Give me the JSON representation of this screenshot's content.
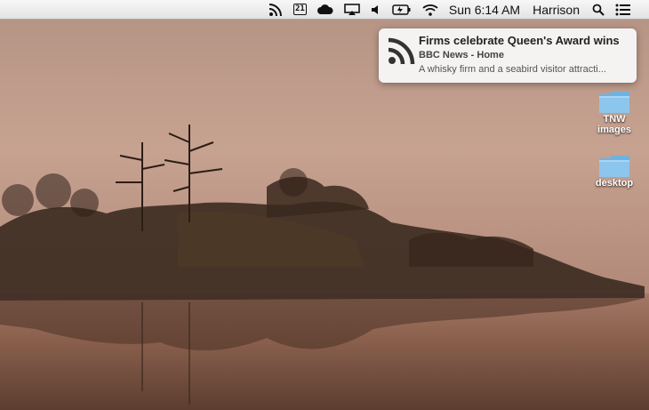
{
  "menubar": {
    "clock": "Sun 6:14 AM",
    "user": "Harrison",
    "calendar_day": "21",
    "icons": [
      "rss-icon",
      "calendar-icon",
      "cloud-icon",
      "airplay-icon",
      "volume-icon",
      "battery-icon",
      "wifi-icon",
      "spotlight-icon",
      "notification-center-icon"
    ]
  },
  "notification": {
    "title": "Firms celebrate Queen's Award wins",
    "source": "BBC News - Home",
    "body": "A whisky firm and a seabird visitor attracti..."
  },
  "desktop": {
    "icons": [
      {
        "label_line1": "TNW",
        "label_line2": "images",
        "icon": "folder-icon"
      },
      {
        "label_line1": "desktop",
        "icon": "folder-icon"
      }
    ]
  }
}
